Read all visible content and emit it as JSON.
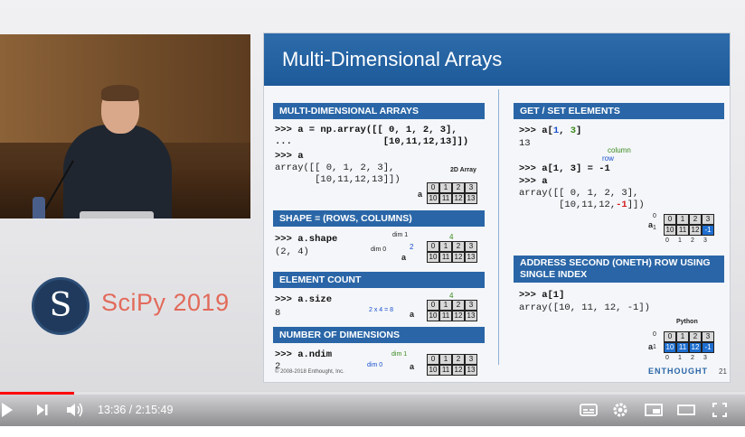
{
  "player": {
    "current_time": "13:36",
    "separator": " / ",
    "duration": "2:15:49",
    "progress_fraction": 0.1001,
    "icons": {
      "play": "play-icon",
      "next": "next-icon",
      "volume": "volume-icon",
      "subtitles": "subtitles-icon",
      "settings": "gear-icon",
      "miniplayer": "miniplayer-icon",
      "theater": "theater-icon",
      "fullscreen": "fullscreen-icon"
    }
  },
  "branding": {
    "conference": "SciPy 2019",
    "logo_letter": "S",
    "accent": "#e26a5a"
  },
  "slide": {
    "title": "Multi-Dimensional Arrays",
    "copyright": "© 2008-2018 Enthought, Inc.",
    "footer_logo": "ENTHOUGHT",
    "page_number": "21",
    "sections": {
      "md_arrays": {
        "heading": "MULTI-DIMENSIONAL ARRAYS",
        "code1": ">>> a = np.array([[ 0, 1, 2, 3],",
        "code2": "...                [10,11,12,13]])",
        "code3": ">>> a",
        "code4": "array([[ 0, 1, 2, 3],",
        "code5": "       [10,11,12,13]])",
        "diagram_label": "2D Array",
        "diagram_var": "a"
      },
      "shape": {
        "heading": "SHAPE = (ROWS, COLUMNS)",
        "code1": ">>> a.shape",
        "code2": "(2, 4)",
        "dim1": "dim 1",
        "dim0": "dim 0",
        "rows_count": "2",
        "cols_count": "4",
        "diagram_var": "a"
      },
      "element_count": {
        "heading": "ELEMENT COUNT",
        "code1": ">>> a.size",
        "code2": "8",
        "formula": "2 x 4 = 8",
        "cols_count": "4",
        "diagram_var": "a"
      },
      "ndim": {
        "heading": "NUMBER OF DIMENSIONS",
        "code1": ">>> a.ndim",
        "code2": "2",
        "dim1": "dim 1",
        "dim0": "dim 0",
        "diagram_var": "a"
      },
      "get_set": {
        "heading": "GET / SET ELEMENTS",
        "code1_prefix": ">>> a[",
        "code1_row": "1",
        "code1_sep": ", ",
        "code1_col": "3",
        "code1_suffix": "]",
        "code2": "13",
        "column_label": "column",
        "row_label": "row",
        "code3": ">>> a[1, 3] = -1",
        "code4": ">>> a",
        "code5": "array([[ 0, 1, 2, 3],",
        "code6_prefix": "       [10,11,12,",
        "code6_value": "-1",
        "code6_suffix": "]])",
        "diagram_var": "a",
        "row_idx0": "0",
        "row_idx1": "1",
        "col_indices": [
          "0",
          "1",
          "2",
          "3"
        ]
      },
      "address_row": {
        "heading_line1": "ADDRESS SECOND (ONETH) ROW USING",
        "heading_line2": "SINGLE INDEX",
        "code1": ">>> a[1]",
        "code2": "array([10, 11, 12, -1])",
        "diagram_label": "Python",
        "diagram_var": "a",
        "row_idx0": "0",
        "row_idx1": "1",
        "col_indices": [
          "0",
          "1",
          "2",
          "3"
        ]
      }
    },
    "grid_row0": [
      "0",
      "1",
      "2",
      "3"
    ],
    "grid_row1": [
      "10",
      "11",
      "12",
      "13"
    ],
    "grid_row1_modified": [
      "10",
      "11",
      "12",
      "-1"
    ],
    "colors": {
      "header_blue": "#2a66a7",
      "highlight_blue": "#1f6fd0",
      "value_red": "#d21a1a",
      "column_green": "#3b8a1f"
    }
  }
}
